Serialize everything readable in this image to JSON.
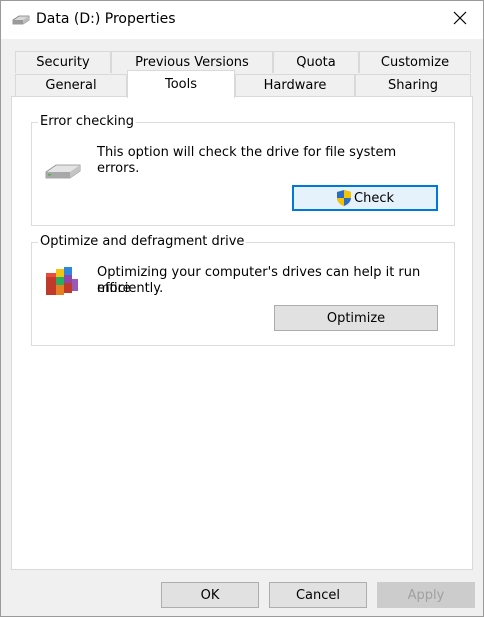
{
  "window": {
    "title": "Data (D:) Properties"
  },
  "tabs": {
    "row1": [
      "Security",
      "Previous Versions",
      "Quota",
      "Customize"
    ],
    "row2": [
      "General",
      "Tools",
      "Hardware",
      "Sharing"
    ],
    "active": "Tools"
  },
  "error_checking": {
    "title": "Error checking",
    "description_line1": "This option will check the drive for file system",
    "description_line2": "errors.",
    "button_label": "Check",
    "icon": "drive-icon"
  },
  "optimize": {
    "title": "Optimize and defragment drive",
    "description_line1": "Optimizing your computer's drives can help it run more",
    "description_line2": "efficiently.",
    "button_label": "Optimize",
    "icon": "defrag-icon"
  },
  "footer": {
    "ok_label": "OK",
    "cancel_label": "Cancel",
    "apply_label": "Apply"
  },
  "colors": {
    "accent": "#0078d7",
    "window_bg": "#f0f0f0",
    "panel_bg": "#ffffff"
  }
}
